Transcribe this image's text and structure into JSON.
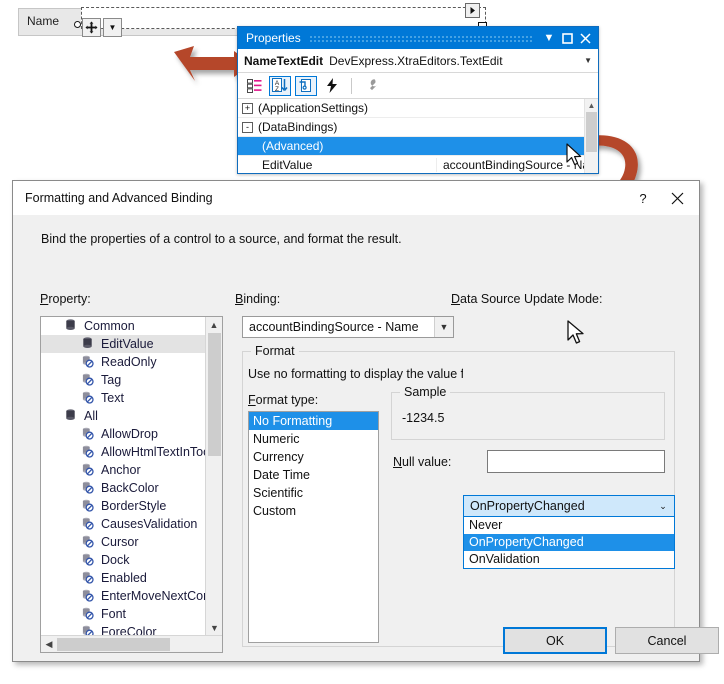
{
  "designer": {
    "label": "Name",
    "smarttag_icon": "move-icon",
    "dropdown_icon": "chevron-down-icon",
    "tag_icon": "smart-tag-icon"
  },
  "properties_window": {
    "title": "Properties",
    "minimize_icon": "chevron-down-icon",
    "maximize_icon": "maximize-icon",
    "close_icon": "close-icon",
    "object_name": "NameTextEdit",
    "object_type": "DevExpress.XtraEditors.TextEdit",
    "object_caret_icon": "chevron-down-icon",
    "toolbar": [
      {
        "name": "categorized-icon",
        "selected": false
      },
      {
        "name": "alphabetical-sort-icon",
        "selected": true
      },
      {
        "name": "properties-page-icon",
        "selected": true
      },
      {
        "name": "events-lightning-icon",
        "selected": false
      },
      {
        "name": "property-pages-wrench-icon",
        "selected": false
      }
    ],
    "rows": [
      {
        "name": "(ApplicationSettings)",
        "value": "",
        "expander": "+",
        "indent": 0,
        "selected": false,
        "has_ellipsis": false
      },
      {
        "name": "(DataBindings)",
        "value": "",
        "expander": "-",
        "indent": 0,
        "selected": false,
        "has_ellipsis": false
      },
      {
        "name": "(Advanced)",
        "value": "",
        "expander": "",
        "indent": 1,
        "selected": true,
        "has_ellipsis": true
      },
      {
        "name": "EditValue",
        "value": "accountBindingSource - Name",
        "expander": "",
        "indent": 1,
        "selected": false,
        "has_ellipsis": false
      }
    ],
    "ellipsis_label": "...",
    "scroll_up_icon": "triangle-up-icon"
  },
  "dialog": {
    "title": "Formatting and Advanced Binding",
    "help_label": "?",
    "close_icon": "close-icon",
    "description": "Bind the properties of a control to a source, and format the result.",
    "property_label": "Property:",
    "property_label_accel": "P",
    "binding_label": "Binding:",
    "binding_label_accel": "B",
    "update_mode_label": "Data Source Update Mode:",
    "update_mode_label_accel": "D",
    "tree": {
      "nodes": [
        {
          "label": "Common",
          "level": 0,
          "icon": "category-icon",
          "selected": false
        },
        {
          "label": "EditValue",
          "level": 1,
          "icon": "bound-property-icon",
          "selected": true
        },
        {
          "label": "ReadOnly",
          "level": 1,
          "icon": "unbound-property-icon",
          "selected": false
        },
        {
          "label": "Tag",
          "level": 1,
          "icon": "unbound-property-icon",
          "selected": false
        },
        {
          "label": "Text",
          "level": 1,
          "icon": "unbound-property-icon",
          "selected": false
        },
        {
          "label": "All",
          "level": 0,
          "icon": "category-icon",
          "selected": false
        },
        {
          "label": "AllowDrop",
          "level": 1,
          "icon": "unbound-property-icon",
          "selected": false
        },
        {
          "label": "AllowHtmlTextInToo",
          "level": 1,
          "icon": "unbound-property-icon",
          "selected": false
        },
        {
          "label": "Anchor",
          "level": 1,
          "icon": "unbound-property-icon",
          "selected": false
        },
        {
          "label": "BackColor",
          "level": 1,
          "icon": "unbound-property-icon",
          "selected": false
        },
        {
          "label": "BorderStyle",
          "level": 1,
          "icon": "unbound-property-icon",
          "selected": false
        },
        {
          "label": "CausesValidation",
          "level": 1,
          "icon": "unbound-property-icon",
          "selected": false
        },
        {
          "label": "Cursor",
          "level": 1,
          "icon": "unbound-property-icon",
          "selected": false
        },
        {
          "label": "Dock",
          "level": 1,
          "icon": "unbound-property-icon",
          "selected": false
        },
        {
          "label": "Enabled",
          "level": 1,
          "icon": "unbound-property-icon",
          "selected": false
        },
        {
          "label": "EnterMoveNextCont",
          "level": 1,
          "icon": "unbound-property-icon",
          "selected": false
        },
        {
          "label": "Font",
          "level": 1,
          "icon": "unbound-property-icon",
          "selected": false
        },
        {
          "label": "ForeColor",
          "level": 1,
          "icon": "unbound-property-icon",
          "selected": false
        }
      ],
      "scroll_up_icon": "chevron-up-icon",
      "scroll_down_icon": "chevron-down-icon",
      "scroll_left_icon": "chevron-left-icon",
      "scroll_right_icon": "chevron-right-icon"
    },
    "binding_combo": {
      "value": "accountBindingSource - Name",
      "arrow_icon": "chevron-down-icon"
    },
    "update_mode_combo": {
      "value": "OnPropertyChanged",
      "arrow_icon": "chevron-up-icon",
      "options": [
        {
          "label": "Never",
          "highlighted": false
        },
        {
          "label": "OnPropertyChanged",
          "highlighted": true
        },
        {
          "label": "OnValidation",
          "highlighted": false
        }
      ]
    },
    "format_group": {
      "caption": "Format",
      "hint": "Use no formatting to display the value fr",
      "type_label": "Format type:",
      "type_label_accel": "F",
      "types": [
        {
          "label": "No Formatting",
          "selected": true
        },
        {
          "label": "Numeric",
          "selected": false
        },
        {
          "label": "Currency",
          "selected": false
        },
        {
          "label": "Date Time",
          "selected": false
        },
        {
          "label": "Scientific",
          "selected": false
        },
        {
          "label": "Custom",
          "selected": false
        }
      ]
    },
    "sample": {
      "caption": "Sample",
      "value": "-1234.5"
    },
    "null_value": {
      "label": "Null value:",
      "label_accel": "N",
      "value": "",
      "placeholder": ""
    },
    "ok_label": "OK",
    "cancel_label": "Cancel"
  },
  "annotations": {
    "arrow_color": "#b5472c",
    "arrow1_name": "callout-arrow-to-properties",
    "arrow2_name": "callout-arrow-to-dialog"
  },
  "cursors": {
    "grid_cursor": "mouse-pointer",
    "dropdown_cursor": "mouse-pointer"
  }
}
